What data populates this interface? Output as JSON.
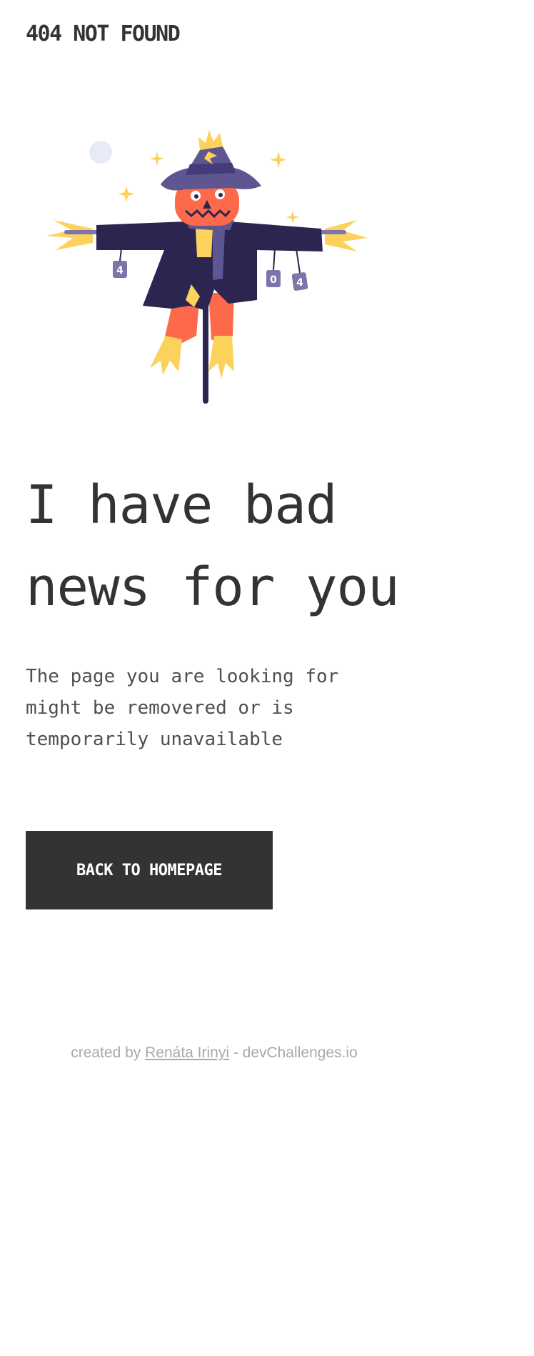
{
  "header": {
    "brand": "404 NOT FOUND"
  },
  "illustration": {
    "cans": [
      "4",
      "0",
      "4"
    ]
  },
  "main": {
    "headline_line1": "I have bad",
    "headline_line2": "news for you",
    "description_line1": "The page you are looking for",
    "description_line2": "might be removered or is",
    "description_line3": "temporarily unavailable",
    "button_label": "BACK TO HOMEPAGE"
  },
  "footer": {
    "prefix": "created by ",
    "author": "Renáta Irinyi",
    "suffix": " - devChallenges.io"
  },
  "colors": {
    "text": "#333333",
    "button_bg": "#333333",
    "button_text": "#ffffff",
    "footer_text": "#a9a9a9",
    "hat": "#5e5690",
    "coat": "#2c2550",
    "pumpkin": "#fd6a4b",
    "straw": "#fdd25c"
  }
}
